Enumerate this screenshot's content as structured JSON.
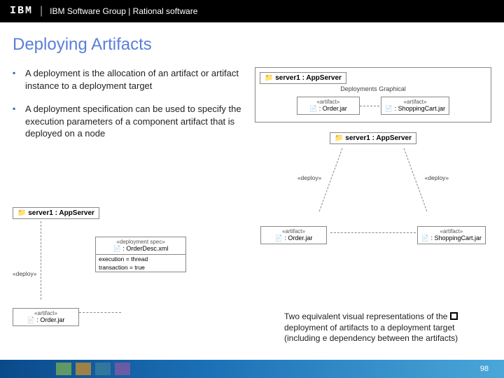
{
  "header": {
    "brand": "IBM",
    "text": "IBM Software Group | Rational software"
  },
  "title": "Deploying Artifacts",
  "bullets": [
    "A deployment is the allocation of an artifact or artifact instance to a deployment target",
    "A deployment specification can be used to specify the execution parameters of a component artifact that is deployed on a node"
  ],
  "diagram_top": {
    "server": "server1 : AppServer",
    "sub": "Deployments Graphical",
    "artifacts": [
      {
        "stereo": "«artifact»",
        "name": ": Order.jar"
      },
      {
        "stereo": "«artifact»",
        "name": ": ShoppingCart.jar"
      }
    ]
  },
  "diagram_mid": {
    "server": "server1 : AppServer",
    "deploy_left": "«deploy»",
    "deploy_right": "«deploy»",
    "artifacts": [
      {
        "stereo": "«artifact»",
        "name": ": Order.jar"
      },
      {
        "stereo": "«artifact»",
        "name": ": ShoppingCart.jar"
      }
    ]
  },
  "diagram_bl": {
    "server": "server1 : AppServer",
    "spec": {
      "stereo": "«deployment spec»",
      "name": ": OrderDesc.xml",
      "rows": [
        "execution = thread",
        "transaction = true"
      ]
    },
    "deploy": "«deploy»",
    "artifact": {
      "stereo": "«artifact»",
      "name": ": Order.jar"
    }
  },
  "caption": {
    "pre": "Two equivalent visual representations of the ",
    "post": " deployment of artifacts to a deployment target (including e dependency between the artifacts)"
  },
  "page": "98"
}
